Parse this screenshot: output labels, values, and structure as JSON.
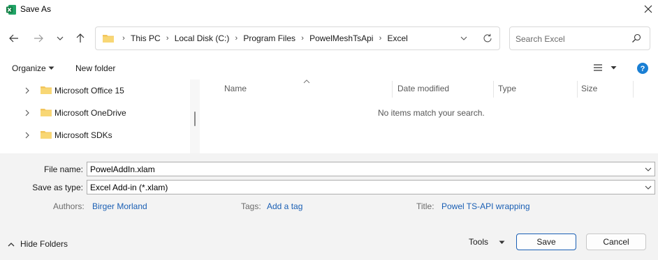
{
  "window": {
    "title": "Save As",
    "app_icon": "excel-icon",
    "close_icon": "close-icon"
  },
  "nav": {
    "back_icon": "arrow-left-icon",
    "forward_icon": "arrow-right-icon",
    "recent_icon": "chevron-down-icon",
    "up_icon": "arrow-up-icon"
  },
  "address": {
    "crumbs": [
      "This PC",
      "Local Disk (C:)",
      "Program Files",
      "PowelMeshTsApi",
      "Excel"
    ],
    "refresh_icon": "refresh-icon"
  },
  "search": {
    "placeholder": "Search Excel",
    "icon": "search-icon"
  },
  "toolbar": {
    "organize_label": "Organize",
    "new_folder_label": "New folder",
    "view_icon": "view-list-icon",
    "help_icon": "help-icon"
  },
  "tree": {
    "items": [
      {
        "label": "Microsoft Office 15"
      },
      {
        "label": "Microsoft OneDrive"
      },
      {
        "label": "Microsoft SDKs"
      }
    ]
  },
  "files": {
    "columns": [
      "Name",
      "Date modified",
      "Type",
      "Size"
    ],
    "empty_message": "No items match your search."
  },
  "form": {
    "file_name_label": "File name:",
    "file_name_value": "PowelAddIn.xlam",
    "save_type_label": "Save as type:",
    "save_type_value": "Excel Add-in (*.xlam)",
    "authors_label": "Authors:",
    "authors_value": "Birger Morland",
    "tags_label": "Tags:",
    "tags_value": "Add a tag",
    "title_label": "Title:",
    "title_value": "Powel TS-API wrapping"
  },
  "footer": {
    "hide_folders_label": "Hide Folders",
    "tools_label": "Tools",
    "save_label": "Save",
    "cancel_label": "Cancel"
  },
  "colors": {
    "accent": "#1a5fb4",
    "folder": "#f2c55c",
    "excel": "#1d6f42"
  }
}
